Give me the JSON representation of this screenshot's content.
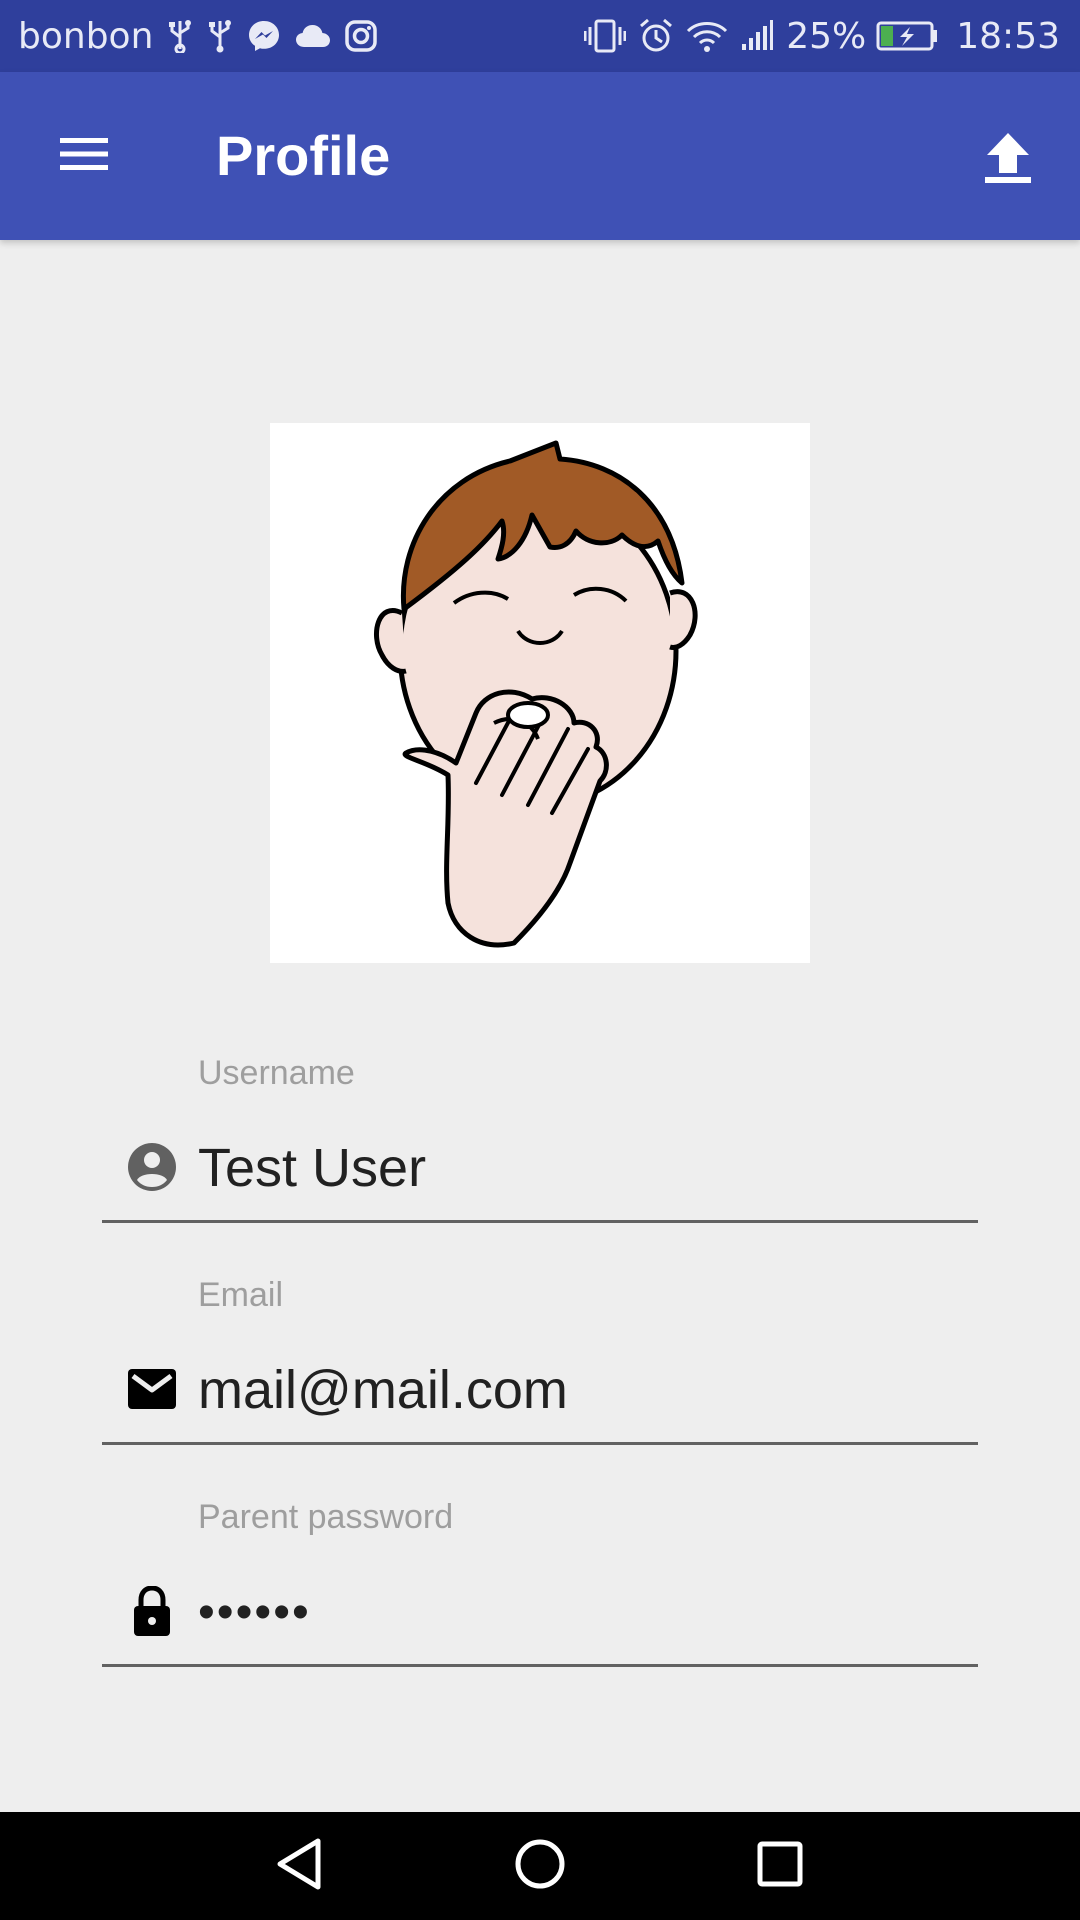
{
  "status_bar": {
    "carrier": "bonbon",
    "battery_percent": "25%",
    "time": "18:53",
    "battery_level": 0.25,
    "left_icons": [
      "usb-icon",
      "usb-icon",
      "messenger-icon",
      "cloud-icon",
      "instagram-icon"
    ],
    "right_icons": [
      "vibrate-icon",
      "alarm-icon",
      "wifi-icon",
      "signal-icon",
      "battery-charging-icon"
    ]
  },
  "app_bar": {
    "title": "Profile",
    "menu_icon": "menu-icon",
    "action_icon": "upload-icon",
    "color": "#3f51b5",
    "status_color": "#2f3f9c"
  },
  "avatar": {
    "icon": "yawning-boy-illustration"
  },
  "form": {
    "username": {
      "label": "Username",
      "value": "Test User",
      "icon": "account-circle-icon"
    },
    "email": {
      "label": "Email",
      "value": "mail@mail.com",
      "icon": "email-icon"
    },
    "password": {
      "label": "Parent password",
      "value": "••••••",
      "icon": "lock-icon"
    }
  },
  "nav_bar": {
    "icons": [
      "back-icon",
      "home-icon",
      "recent-apps-icon"
    ]
  }
}
